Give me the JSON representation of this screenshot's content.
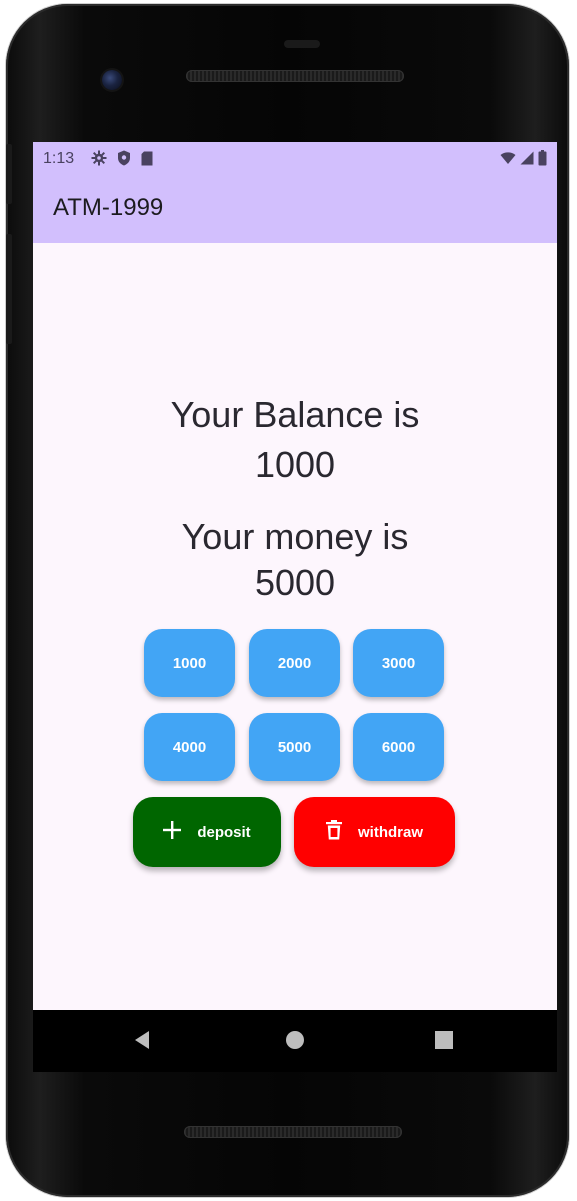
{
  "status_bar": {
    "time": "1:13",
    "left_icons": [
      "settings-icon",
      "shield-icon",
      "sim-card-icon"
    ],
    "right_icons": [
      "wifi-icon",
      "signal-icon",
      "battery-icon"
    ]
  },
  "app_bar": {
    "title": "ATM-1999"
  },
  "balance": {
    "label": "Your Balance is",
    "value": "1000"
  },
  "money": {
    "label": "Your money is",
    "value": "5000"
  },
  "amount_buttons": [
    {
      "label": "1000"
    },
    {
      "label": "2000"
    },
    {
      "label": "3000"
    },
    {
      "label": "4000"
    },
    {
      "label": "5000"
    },
    {
      "label": "6000"
    }
  ],
  "actions": {
    "deposit_label": "deposit",
    "withdraw_label": "withdraw",
    "deposit_icon": "plus-icon",
    "withdraw_icon": "trash-icon"
  },
  "nav_bar": {
    "icons": [
      "back-icon",
      "home-icon",
      "recents-icon"
    ]
  },
  "colors": {
    "app_bar": "#d2bffd",
    "screen_bg": "#fdf6fd",
    "amount_button": "#42a5f5",
    "deposit_button": "#006600",
    "withdraw_button": "#ff0000"
  }
}
